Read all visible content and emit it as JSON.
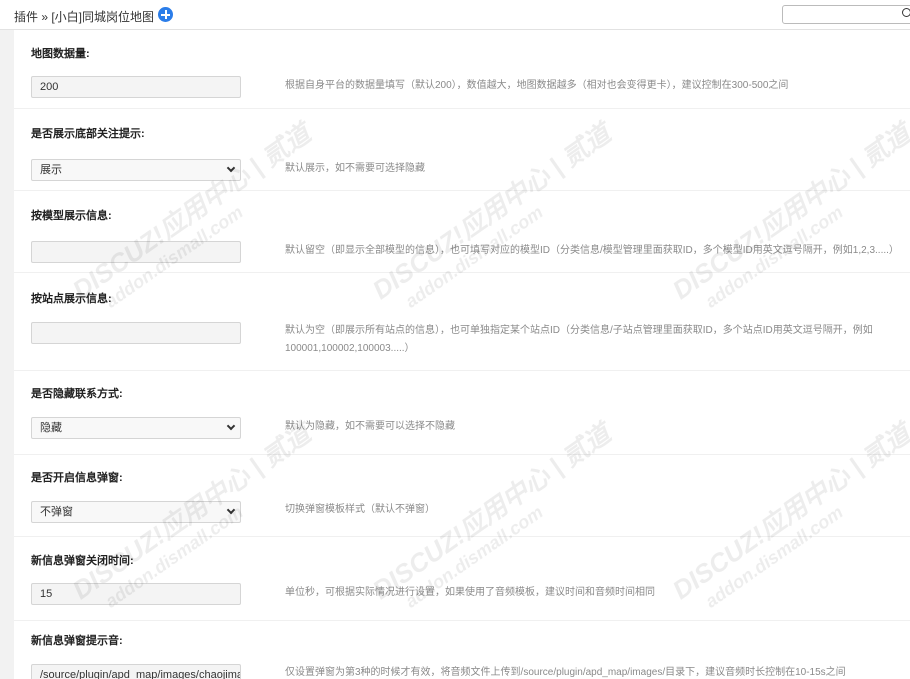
{
  "header": {
    "breadcrumb": "插件 » [小白]同城岗位地图"
  },
  "watermark": {
    "line1": "DISCUZ!应用中心 | 贰道",
    "line2": "addon.dismall.com"
  },
  "settings": [
    {
      "label": "地图数据量:",
      "type": "text",
      "value": "200",
      "desc": "根据自身平台的数据量填写（默认200），数值越大，地图数据越多（相对也会变得更卡），建议控制在300-500之间"
    },
    {
      "label": "是否展示底部关注提示:",
      "type": "select",
      "value": "展示",
      "desc": "默认展示，如不需要可选择隐藏"
    },
    {
      "label": "按模型展示信息:",
      "type": "text",
      "value": "",
      "desc": "默认留空（即显示全部模型的信息），也可填写对应的模型ID（分类信息/模型管理里面获取ID，多个模型ID用英文逗号隔开，例如1,2,3.....）"
    },
    {
      "label": "按站点展示信息:",
      "type": "text",
      "value": "",
      "desc": "默认为空（即展示所有站点的信息），也可单独指定某个站点ID（分类信息/子站点管理里面获取ID，多个站点ID用英文逗号隔开，例如100001,100002,100003.....）"
    },
    {
      "label": "是否隐藏联系方式:",
      "type": "select",
      "value": "隐藏",
      "desc": "默认为隐藏，如不需要可以选择不隐藏"
    },
    {
      "label": "是否开启信息弹窗:",
      "type": "select",
      "value": "不弹窗",
      "desc": "切换弹窗模板样式（默认不弹窗）"
    },
    {
      "label": "新信息弹窗关闭时间:",
      "type": "text",
      "value": "15",
      "desc": "单位秒，可根据实际情况进行设置，如果使用了音频模板，建议时间和音频时间相同"
    },
    {
      "label": "新信息弹窗提示音:",
      "type": "text",
      "value": "/source/plugin/apd_map/images/chaojimali.r",
      "desc": "仅设置弹窗为第3种的时候才有效，将音频文件上传到/source/plugin/apd_map/images/目录下，建议音频时长控制在10-15s之间"
    }
  ]
}
